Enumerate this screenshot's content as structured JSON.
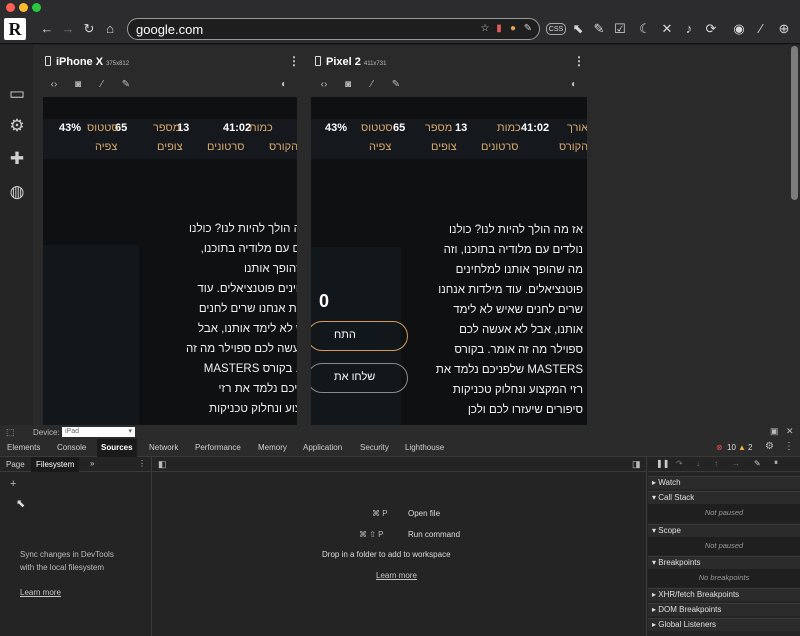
{
  "browser": {
    "url": "google.com",
    "colors": {
      "close": "#ff5f57",
      "minimize": "#febc2e",
      "maximize": "#28c840",
      "accent_orange": "#d9a96c"
    },
    "logo_text": "R",
    "toolbar_icons": [
      "back-icon",
      "forward-icon",
      "reload-icon",
      "home-icon",
      "star-icon",
      "bookmark-icon",
      "extension-icon",
      "edit-icon",
      "css-icon",
      "cursor-icon",
      "edit-note-icon",
      "edit-box-icon",
      "moon-icon",
      "mute-icon",
      "volume-icon",
      "rotate-icon",
      "add-screenshot-icon",
      "eyedropper-icon",
      "zoom-in-icon"
    ],
    "css_label": "CSS"
  },
  "sidebar": {
    "icons": [
      "devices-icon",
      "settings-icon",
      "extensions-icon",
      "globe-icon"
    ]
  },
  "devices": [
    {
      "name": "iPhone X",
      "size": "375x812"
    },
    {
      "name": "Pixel 2",
      "size": "411x731"
    }
  ],
  "page_content": {
    "stats": {
      "percent": "43%",
      "status_val": "65",
      "status_label": "סטטוס",
      "status_label2": "צפיה",
      "number_val": "13",
      "number_label": "מספר",
      "number_label2": "צופים",
      "count_val": "41:02",
      "count_label": "כמות",
      "count_label2": "סרטונים",
      "length_label": "אורך",
      "length_label2": "הקורס"
    },
    "big_number": "0",
    "button1": "התח",
    "button2": "שלחו את",
    "lines_iphone": [
      "אז מה הולך להיות לנו? כולנו",
      "נולדים עם מלודיה בתוכנו,",
      "מה שהופך אותנו",
      "למלחינים פוטנציאלים. עוד",
      "מילדות אנחנו שרים לחנים",
      "שאיש לא לימד אותנו, אבל",
      "לא אעשה לכם ספוילר מה זה",
      "אומר. בקורס MASTERS",
      "שלפניכם נלמד את רזי",
      "המקצוע ונחלוק טכניקות"
    ],
    "lines_pixel": [
      "אז מה הולך להיות לנו? כולנו",
      "נולדים עם מלודיה בתוכנו, וזה",
      "מה שהופך אותנו למלחינים",
      "פוטנציאלים. עוד מילדות אנחנו",
      "שרים לחנים שאיש לא לימד",
      "אותנו, אבל לא אעשה לכם",
      "ספוילר מה זה אומר. בקורס",
      "MASTERS שלפניכם נלמד את",
      "רזי המקצוע ונחלוק טכניקות",
      "סיפורים שיעזרו לכם ולכן"
    ]
  },
  "devtools": {
    "device_label": "Device:",
    "device_value": "iPad",
    "tabs": [
      "Elements",
      "Console",
      "Sources",
      "Network",
      "Performance",
      "Memory",
      "Application",
      "Security",
      "Lighthouse"
    ],
    "errors": "10",
    "warnings": "2",
    "subtabs": [
      "Page",
      "Filesystem"
    ],
    "overflow": "»",
    "sync_text1": "Sync changes in DevTools",
    "sync_text2": "with the local filesystem",
    "learn_more": "Learn more",
    "shortcut1_keys": "⌘ P",
    "shortcut1_label": "Open file",
    "shortcut2_keys": "⌘ ⇧ P",
    "shortcut2_label": "Run command",
    "drop_text": "Drop in a folder to add to workspace",
    "learn_more2": "Learn more",
    "panes": [
      {
        "title": "Watch",
        "body": ""
      },
      {
        "title": "Call Stack",
        "body": "Not paused"
      },
      {
        "title": "Scope",
        "body": "Not paused"
      },
      {
        "title": "Breakpoints",
        "body": "No breakpoints"
      },
      {
        "title": "XHR/fetch Breakpoints",
        "body": ""
      },
      {
        "title": "DOM Breakpoints",
        "body": ""
      },
      {
        "title": "Global Listeners",
        "body": ""
      }
    ]
  }
}
